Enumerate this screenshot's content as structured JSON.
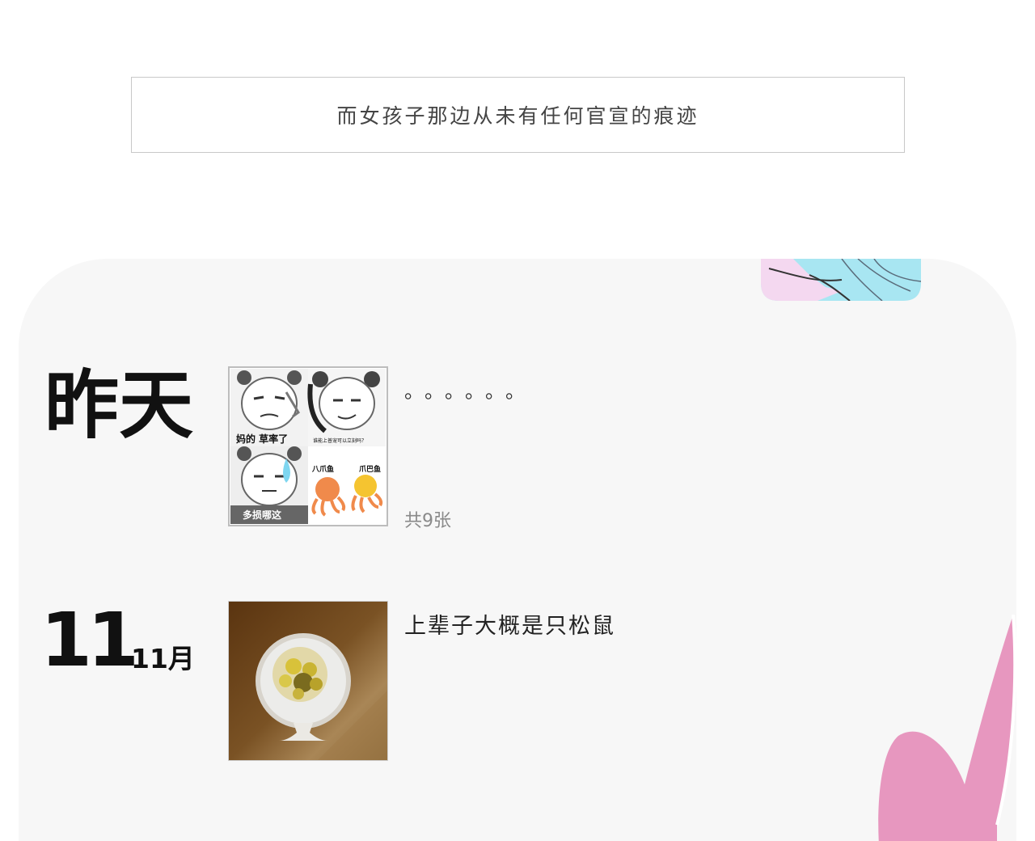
{
  "caption": {
    "text": "而女孩子那边从未有任何官宣的痕迹"
  },
  "timeline": {
    "entries": [
      {
        "date_label": "昨天",
        "text": "。。。。。。",
        "image_count": "共9张",
        "collage_captions": [
          "妈的 草率了",
          "谁能上普宠可以立刻吗？",
          "多损哪这",
          "八爪鱼",
          "爪巴鱼"
        ]
      },
      {
        "day": "11",
        "month": "11月",
        "text": "上辈子大概是只松鼠"
      }
    ]
  },
  "colors": {
    "panel_bg": "#f7f7f7",
    "pink_accent": "#e797bf",
    "light_blue": "#a8e6f2",
    "photo_brown": "#6b4420"
  },
  "icons": [
    "anime-illustration-fragment",
    "pink-decoration-shape"
  ]
}
